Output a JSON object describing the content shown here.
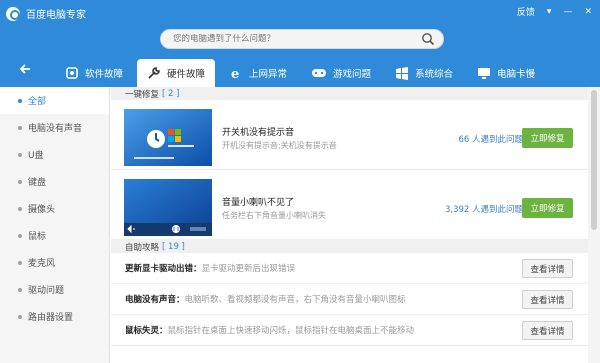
{
  "app": {
    "title": "百度电脑专家"
  },
  "window": {
    "feedback": "反馈",
    "menu": "▾",
    "minimize": "—",
    "close": "✕"
  },
  "search": {
    "placeholder": "您的电脑遇到了什么问题？"
  },
  "tabs": [
    {
      "label": "软件故障",
      "icon": "software-fault-icon"
    },
    {
      "label": "硬件故障",
      "icon": "wrench-icon",
      "active": true
    },
    {
      "label": "上网异常",
      "icon": "ie-icon"
    },
    {
      "label": "游戏问题",
      "icon": "gamepad-icon"
    },
    {
      "label": "系统综合",
      "icon": "windows-icon"
    },
    {
      "label": "电脑卡慢",
      "icon": "monitor-icon"
    }
  ],
  "sidebar": {
    "items": [
      {
        "label": "全部",
        "active": true
      },
      {
        "label": "电脑没有声音"
      },
      {
        "label": "U盘"
      },
      {
        "label": "键盘"
      },
      {
        "label": "摄像头"
      },
      {
        "label": "鼠标"
      },
      {
        "label": "麦克风"
      },
      {
        "label": "驱动问题"
      },
      {
        "label": "路由器设置"
      }
    ]
  },
  "quick_fix": {
    "title": "一键修复",
    "count": "[ 2 ]",
    "items": [
      {
        "title": "开关机没有提示音",
        "desc": "开机没有提示音;关机没有提示音",
        "count": "66 人遇到此问题",
        "button": "立即修复"
      },
      {
        "title": "音量小喇叭不见了",
        "desc": "任务栏右下角音量小喇叭消失",
        "count": "3,392 人遇到此问题",
        "button": "立即修复"
      }
    ]
  },
  "guides": {
    "title": "自助攻略",
    "count": "[ 19 ]",
    "items": [
      {
        "title": "更新显卡驱动出错：",
        "desc": "显卡驱动更新后出现错误",
        "button": "查看详情"
      },
      {
        "title": "电脑没有声音：",
        "desc": "电脑听歌、看视频都没有声音，右下角没有音量小喇叭图标",
        "button": "查看详情"
      },
      {
        "title": "鼠标失灵：",
        "desc": "鼠标指针在桌面上快速移动闪烁，鼠标指针在电脑桌面上不能移动",
        "button": "查看详情"
      }
    ]
  },
  "colors": {
    "header": "#2f8bd9",
    "fix_button": "#6cb33f",
    "link": "#3a7fc4"
  }
}
